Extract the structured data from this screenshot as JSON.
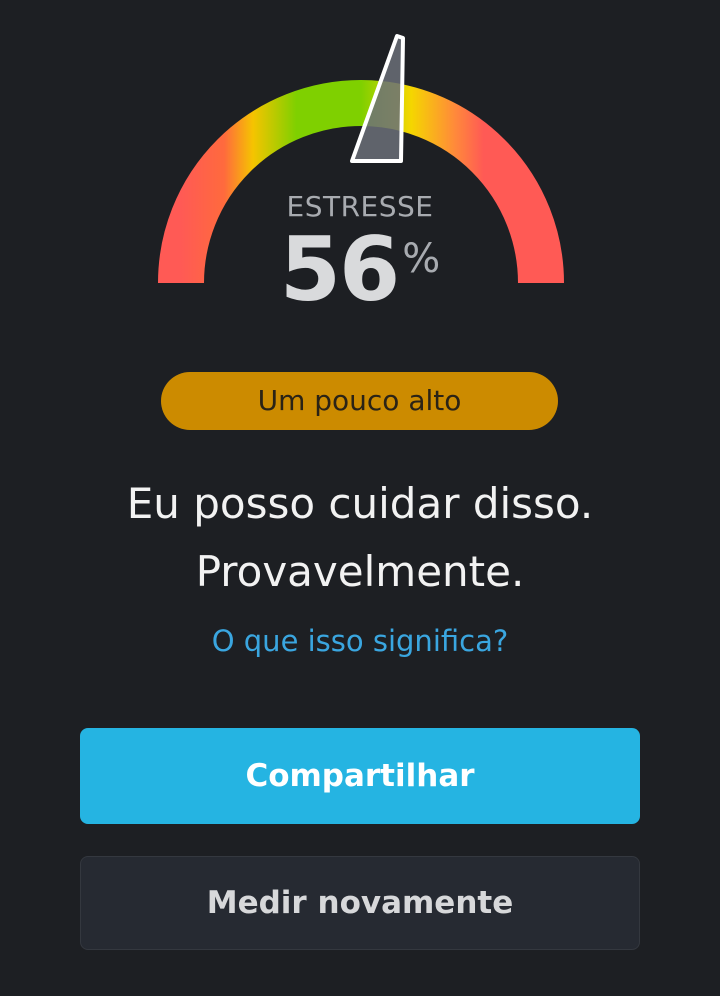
{
  "gauge": {
    "label": "ESTRESSE",
    "value": "56",
    "unit": "%",
    "level_fraction": 0.56
  },
  "level_badge": {
    "text": "Um pouco alto",
    "color": "#cc8b00"
  },
  "message": {
    "line1": "Eu posso cuidar disso.",
    "line2": "Provavelmente."
  },
  "info_link": {
    "text": "O que isso significa?"
  },
  "buttons": {
    "share_label": "Compartilhar",
    "measure_again_label": "Medir novamente"
  },
  "colors": {
    "background": "#1d1f23",
    "primary_button": "#25b4e2",
    "secondary_button": "#262a32",
    "link": "#3aa6e0",
    "gauge_red": "#ff5a55",
    "gauge_yellow": "#f5d000",
    "gauge_green": "#7fd000"
  }
}
